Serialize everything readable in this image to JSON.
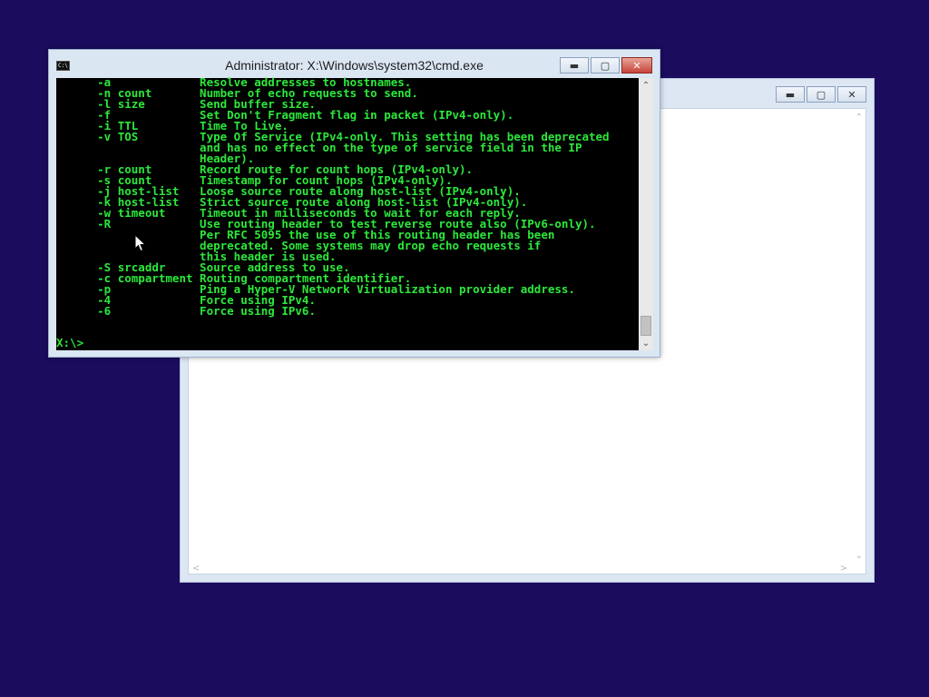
{
  "cmd": {
    "title": "Administrator: X:\\Windows\\system32\\cmd.exe",
    "lines": [
      "      -a             Resolve addresses to hostnames.",
      "      -n count       Number of echo requests to send.",
      "      -l size        Send buffer size.",
      "      -f             Set Don't Fragment flag in packet (IPv4-only).",
      "      -i TTL         Time To Live.",
      "      -v TOS         Type Of Service (IPv4-only. This setting has been deprecated",
      "                     and has no effect on the type of service field in the IP",
      "                     Header).",
      "      -r count       Record route for count hops (IPv4-only).",
      "      -s count       Timestamp for count hops (IPv4-only).",
      "      -j host-list   Loose source route along host-list (IPv4-only).",
      "      -k host-list   Strict source route along host-list (IPv4-only).",
      "      -w timeout     Timeout in milliseconds to wait for each reply.",
      "      -R             Use routing header to test reverse route also (IPv6-only).",
      "                     Per RFC 5095 the use of this routing header has been",
      "                     deprecated. Some systems may drop echo requests if",
      "                     this header is used.",
      "      -S srcaddr     Source address to use.",
      "      -c compartment Routing compartment identifier.",
      "      -p             Ping a Hyper-V Network Virtualization provider address.",
      "      -4             Force using IPv4.",
      "      -6             Force using IPv6."
    ],
    "prompt": "X:\\>",
    "icon": "cmd-icon",
    "text_color": "#2ce83a"
  },
  "back_window": {
    "icon_buttons": [
      "minimize-icon",
      "maximize-icon",
      "close-icon"
    ]
  }
}
